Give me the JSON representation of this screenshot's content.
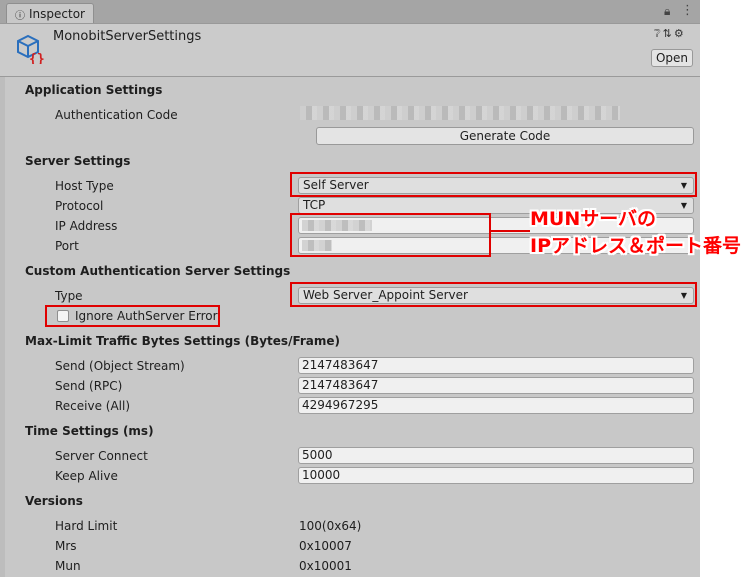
{
  "tab": {
    "label": "Inspector",
    "icon": "info-icon"
  },
  "header": {
    "title": "MonobitServerSettings",
    "open_label": "Open",
    "icons": [
      "help-icon",
      "preset-icon",
      "gear-icon"
    ]
  },
  "application": {
    "title": "Application Settings",
    "auth_code_label": "Authentication Code",
    "generate_label": "Generate Code"
  },
  "server": {
    "title": "Server Settings",
    "host_type_label": "Host Type",
    "host_type_value": "Self Server",
    "protocol_label": "Protocol",
    "protocol_value": "TCP",
    "ip_label": "IP Address",
    "port_label": "Port"
  },
  "custom_auth": {
    "title": "Custom Authentication Server Settings",
    "type_label": "Type",
    "type_value": "Web Server_Appoint Server",
    "ignore_label": "Ignore AuthServer Error"
  },
  "traffic": {
    "title": "Max-Limit Traffic Bytes Settings (Bytes/Frame)",
    "rows": [
      {
        "label": "Send (Object Stream)",
        "value": "2147483647"
      },
      {
        "label": "Send (RPC)",
        "value": "2147483647"
      },
      {
        "label": "Receive (All)",
        "value": "4294967295"
      }
    ]
  },
  "time": {
    "title": "Time Settings (ms)",
    "rows": [
      {
        "label": "Server Connect",
        "value": "5000"
      },
      {
        "label": "Keep Alive",
        "value": "10000"
      }
    ]
  },
  "versions": {
    "title": "Versions",
    "rows": [
      {
        "label": "Hard Limit",
        "value": "100(0x64)"
      },
      {
        "label": "Mrs",
        "value": "0x10007"
      },
      {
        "label": "Mun",
        "value": "0x10001"
      }
    ]
  },
  "annotation": {
    "line1": "MUNサーバの",
    "line2": "IPアドレス＆ポート番号",
    "color": "#ff0000"
  }
}
